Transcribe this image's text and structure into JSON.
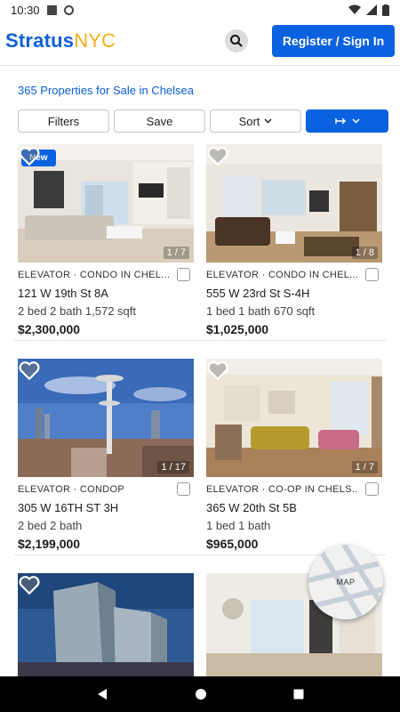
{
  "status_bar": {
    "time": "10:30"
  },
  "header": {
    "logo_bold": "Stratus",
    "logo_light": "NYC",
    "register_label": "Register / Sign In"
  },
  "results": {
    "count_text": "365 Properties for Sale in Chelsea"
  },
  "filters": {
    "filters_label": "Filters",
    "save_label": "Save",
    "sort_label": "Sort"
  },
  "listings": [
    {
      "badge": "New",
      "counter": "1 / 7",
      "tag": "ELEVATOR · CONDO IN CHEL...",
      "address": "121 W 19th St 8A",
      "specs": "2 bed  2 bath  1,572 sqft",
      "price": "$2,300,000"
    },
    {
      "badge": "",
      "counter": "1 / 8",
      "tag": "ELEVATOR · CONDO IN CHEL...",
      "address": "555 W 23rd St S-4H",
      "specs": "1 bed  1 bath  670 sqft",
      "price": "$1,025,000"
    },
    {
      "badge": "",
      "counter": "1 / 17",
      "tag": "ELEVATOR · CONDOP",
      "address": "305 W 16TH ST 3H",
      "specs": "2 bed  2 bath",
      "price": "$2,199,000"
    },
    {
      "badge": "",
      "counter": "1 / 7",
      "tag": "ELEVATOR · CO-OP IN CHELS...",
      "address": "365 W 20th St 5B",
      "specs": "1 bed  1 bath",
      "price": "$965,000"
    },
    {
      "badge": "",
      "counter": "",
      "tag": "",
      "address": "",
      "specs": "",
      "price": ""
    },
    {
      "badge": "",
      "counter": "",
      "tag": "",
      "address": "",
      "specs": "",
      "price": ""
    }
  ],
  "map_button": {
    "label": "MAP"
  },
  "colors": {
    "brand_blue": "#0b62e0",
    "brand_yellow": "#f2b01e"
  },
  "icons": [
    "search-icon",
    "heart-icon",
    "chevron-down-icon",
    "share-icon",
    "back-icon",
    "home-icon",
    "recents-icon"
  ]
}
